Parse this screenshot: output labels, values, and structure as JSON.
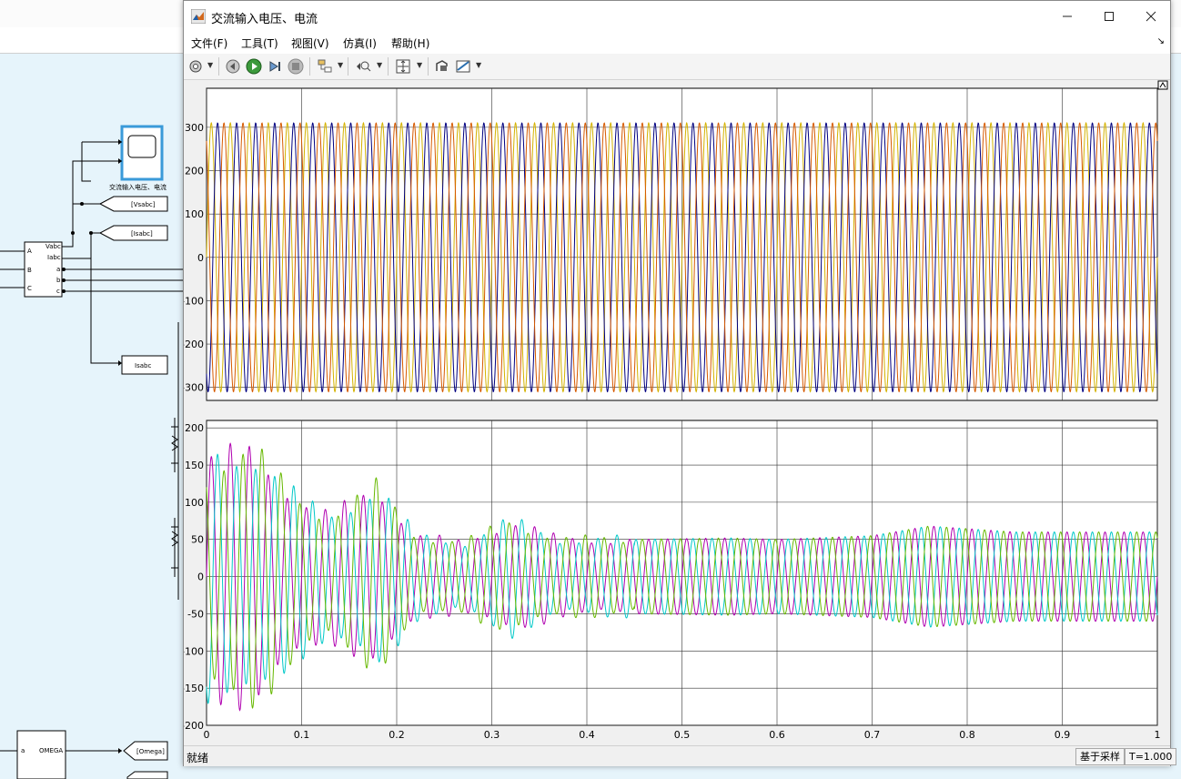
{
  "window": {
    "title": "交流输入电压、电流"
  },
  "menu": {
    "file": "文件(F)",
    "tools": "工具(T)",
    "view": "视图(V)",
    "simulation": "仿真(I)",
    "help": "帮助(H)"
  },
  "status": {
    "left": "就绪",
    "mode": "基于采样",
    "time": "T=1.000"
  },
  "canvas": {
    "scope_block_label": "交流输入电压、电流",
    "tag_vabc": "[Vsabc]",
    "tag_iabc": "[Isabc]",
    "goto_isabc": "Isabc",
    "meas_ports": [
      "A",
      "B",
      "C",
      "Vabc",
      "Iabc",
      "a",
      "b",
      "c"
    ],
    "omega_port": "a",
    "omega_label": "OMEGA",
    "tag_omega": "[Omega]"
  },
  "colors": {
    "window_bg": "#f0f0f0",
    "canvas_bg": "#e6f4fb",
    "plot_bg": "#ffffff",
    "grid": "#333333",
    "yellow": "#d4b200",
    "blue": "#000080",
    "orange": "#d65a00",
    "magenta": "#b000b0",
    "cyan": "#00c8c8",
    "green": "#66b800"
  },
  "chart_data": [
    {
      "type": "line",
      "x_range": [
        0,
        1
      ],
      "ylim": [
        -330,
        390
      ],
      "yticks": [
        300,
        200,
        100,
        0,
        -100,
        -200,
        -300
      ],
      "xticks": [
        "0",
        "0.1",
        "0.2",
        "0.3",
        "0.4",
        "0.5",
        "0.6",
        "0.7",
        "0.8",
        "0.9",
        "1"
      ],
      "grid": true,
      "frequency_hz": 50,
      "series": [
        {
          "amplitude": 310,
          "phase_deg": 0,
          "color": "#d4b200"
        },
        {
          "amplitude": 310,
          "phase_deg": -120,
          "color": "#000080"
        },
        {
          "amplitude": 310,
          "phase_deg": 120,
          "color": "#d65a00"
        }
      ]
    },
    {
      "type": "line",
      "x_range": [
        0,
        1
      ],
      "ylim": [
        -200,
        210
      ],
      "yticks": [
        200,
        150,
        100,
        50,
        0,
        -50,
        -100,
        -150,
        -200
      ],
      "xticks": [
        "0",
        "0.1",
        "0.2",
        "0.3",
        "0.4",
        "0.5",
        "0.6",
        "0.7",
        "0.8",
        "0.9",
        "1"
      ],
      "xticks_values": [
        0,
        0.1,
        0.2,
        0.3,
        0.4,
        0.5,
        0.6,
        0.7,
        0.8,
        0.9,
        1
      ],
      "grid": true,
      "frequency_hz": 50,
      "envelope_x": [
        0,
        0.05,
        0.1,
        0.13,
        0.18,
        0.22,
        0.27,
        0.32,
        0.37,
        0.45,
        0.55,
        0.6,
        0.7,
        0.76,
        0.85,
        1.0
      ],
      "envelope_y": [
        155,
        165,
        100,
        80,
        120,
        55,
        45,
        75,
        50,
        50,
        52,
        50,
        55,
        68,
        60,
        60
      ],
      "series": [
        {
          "phase_deg": 0,
          "color": "#b000b0"
        },
        {
          "phase_deg": -120,
          "color": "#00c8c8"
        },
        {
          "phase_deg": 120,
          "color": "#66b800"
        }
      ]
    }
  ]
}
